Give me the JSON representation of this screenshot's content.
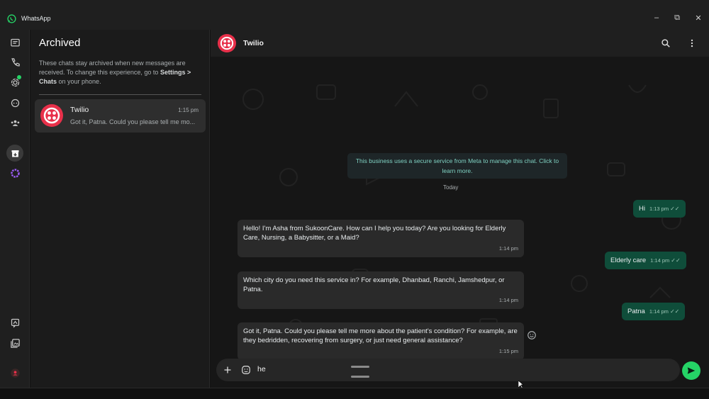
{
  "window": {
    "title": "WhatsApp",
    "minimize": "–",
    "maximize": "⧉",
    "close": "✕"
  },
  "panel": {
    "title": "Archived",
    "info_prefix": "These chats stay archived when new messages are received. To change this experience, go to ",
    "info_bold": "Settings > Chats",
    "info_suffix": " on your phone."
  },
  "chat_list": [
    {
      "name": "Twilio",
      "time": "1:15 pm",
      "preview": "Got it, Patna. Could you please tell me mo..."
    }
  ],
  "conversation": {
    "name": "Twilio",
    "system_message": "This business uses a secure service from Meta to manage this chat. Click to learn more.",
    "date_label": "Today",
    "messages": [
      {
        "dir": "out",
        "text": "Hi",
        "time": "1:13 pm"
      },
      {
        "dir": "in",
        "text": "Hello! I'm Asha from SukoonCare. How can I help you today? Are you looking for Elderly Care, Nursing, a Babysitter, or a Maid?",
        "time": "1:14 pm"
      },
      {
        "dir": "out",
        "text": "Elderly care",
        "time": "1:14 pm"
      },
      {
        "dir": "in",
        "text": "Which city do you need this service in? For example, Dhanbad, Ranchi, Jamshedpur, or Patna.",
        "time": "1:14 pm"
      },
      {
        "dir": "out",
        "text": "Patna",
        "time": "1:14 pm"
      },
      {
        "dir": "in",
        "text": "Got it, Patna. Could you please tell me more about the patient's condition? For example, are they bedridden, recovering from surgery, or just need general assistance?",
        "time": "1:15 pm"
      }
    ]
  },
  "composer": {
    "value": "he"
  },
  "colors": {
    "accent": "#25d366",
    "outgoing_bubble": "#0f4d3a",
    "incoming_bubble": "#2a2a2a",
    "twilio_red": "#e8304a"
  },
  "icons": {
    "rail": [
      "chats-icon",
      "calls-icon",
      "status-icon",
      "channels-icon",
      "communities-icon",
      "archived-icon",
      "meta-ai-icon",
      "starred-icon",
      "media-icon",
      "profile-icon"
    ],
    "header": [
      "search-icon",
      "menu-icon"
    ],
    "composer": [
      "attach-icon",
      "sticker-icon",
      "send-icon"
    ]
  }
}
